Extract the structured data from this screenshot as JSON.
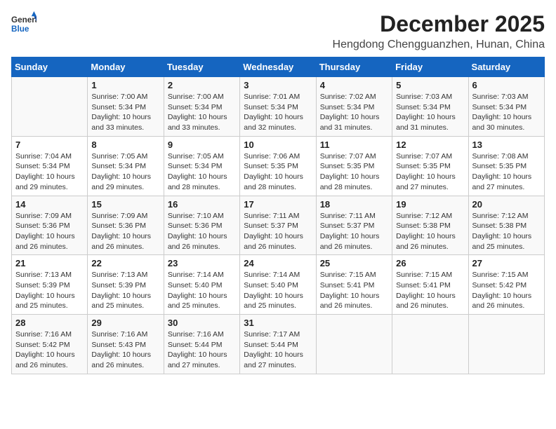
{
  "header": {
    "logo_general": "General",
    "logo_blue": "Blue",
    "month_year": "December 2025",
    "location": "Hengdong Chengguanzhen, Hunan, China"
  },
  "days_of_week": [
    "Sunday",
    "Monday",
    "Tuesday",
    "Wednesday",
    "Thursday",
    "Friday",
    "Saturday"
  ],
  "weeks": [
    [
      {
        "num": "",
        "detail": ""
      },
      {
        "num": "1",
        "detail": "Sunrise: 7:00 AM\nSunset: 5:34 PM\nDaylight: 10 hours\nand 33 minutes."
      },
      {
        "num": "2",
        "detail": "Sunrise: 7:00 AM\nSunset: 5:34 PM\nDaylight: 10 hours\nand 33 minutes."
      },
      {
        "num": "3",
        "detail": "Sunrise: 7:01 AM\nSunset: 5:34 PM\nDaylight: 10 hours\nand 32 minutes."
      },
      {
        "num": "4",
        "detail": "Sunrise: 7:02 AM\nSunset: 5:34 PM\nDaylight: 10 hours\nand 31 minutes."
      },
      {
        "num": "5",
        "detail": "Sunrise: 7:03 AM\nSunset: 5:34 PM\nDaylight: 10 hours\nand 31 minutes."
      },
      {
        "num": "6",
        "detail": "Sunrise: 7:03 AM\nSunset: 5:34 PM\nDaylight: 10 hours\nand 30 minutes."
      }
    ],
    [
      {
        "num": "7",
        "detail": "Sunrise: 7:04 AM\nSunset: 5:34 PM\nDaylight: 10 hours\nand 29 minutes."
      },
      {
        "num": "8",
        "detail": "Sunrise: 7:05 AM\nSunset: 5:34 PM\nDaylight: 10 hours\nand 29 minutes."
      },
      {
        "num": "9",
        "detail": "Sunrise: 7:05 AM\nSunset: 5:34 PM\nDaylight: 10 hours\nand 28 minutes."
      },
      {
        "num": "10",
        "detail": "Sunrise: 7:06 AM\nSunset: 5:35 PM\nDaylight: 10 hours\nand 28 minutes."
      },
      {
        "num": "11",
        "detail": "Sunrise: 7:07 AM\nSunset: 5:35 PM\nDaylight: 10 hours\nand 28 minutes."
      },
      {
        "num": "12",
        "detail": "Sunrise: 7:07 AM\nSunset: 5:35 PM\nDaylight: 10 hours\nand 27 minutes."
      },
      {
        "num": "13",
        "detail": "Sunrise: 7:08 AM\nSunset: 5:35 PM\nDaylight: 10 hours\nand 27 minutes."
      }
    ],
    [
      {
        "num": "14",
        "detail": "Sunrise: 7:09 AM\nSunset: 5:36 PM\nDaylight: 10 hours\nand 26 minutes."
      },
      {
        "num": "15",
        "detail": "Sunrise: 7:09 AM\nSunset: 5:36 PM\nDaylight: 10 hours\nand 26 minutes."
      },
      {
        "num": "16",
        "detail": "Sunrise: 7:10 AM\nSunset: 5:36 PM\nDaylight: 10 hours\nand 26 minutes."
      },
      {
        "num": "17",
        "detail": "Sunrise: 7:11 AM\nSunset: 5:37 PM\nDaylight: 10 hours\nand 26 minutes."
      },
      {
        "num": "18",
        "detail": "Sunrise: 7:11 AM\nSunset: 5:37 PM\nDaylight: 10 hours\nand 26 minutes."
      },
      {
        "num": "19",
        "detail": "Sunrise: 7:12 AM\nSunset: 5:38 PM\nDaylight: 10 hours\nand 26 minutes."
      },
      {
        "num": "20",
        "detail": "Sunrise: 7:12 AM\nSunset: 5:38 PM\nDaylight: 10 hours\nand 25 minutes."
      }
    ],
    [
      {
        "num": "21",
        "detail": "Sunrise: 7:13 AM\nSunset: 5:39 PM\nDaylight: 10 hours\nand 25 minutes."
      },
      {
        "num": "22",
        "detail": "Sunrise: 7:13 AM\nSunset: 5:39 PM\nDaylight: 10 hours\nand 25 minutes."
      },
      {
        "num": "23",
        "detail": "Sunrise: 7:14 AM\nSunset: 5:40 PM\nDaylight: 10 hours\nand 25 minutes."
      },
      {
        "num": "24",
        "detail": "Sunrise: 7:14 AM\nSunset: 5:40 PM\nDaylight: 10 hours\nand 25 minutes."
      },
      {
        "num": "25",
        "detail": "Sunrise: 7:15 AM\nSunset: 5:41 PM\nDaylight: 10 hours\nand 26 minutes."
      },
      {
        "num": "26",
        "detail": "Sunrise: 7:15 AM\nSunset: 5:41 PM\nDaylight: 10 hours\nand 26 minutes."
      },
      {
        "num": "27",
        "detail": "Sunrise: 7:15 AM\nSunset: 5:42 PM\nDaylight: 10 hours\nand 26 minutes."
      }
    ],
    [
      {
        "num": "28",
        "detail": "Sunrise: 7:16 AM\nSunset: 5:42 PM\nDaylight: 10 hours\nand 26 minutes."
      },
      {
        "num": "29",
        "detail": "Sunrise: 7:16 AM\nSunset: 5:43 PM\nDaylight: 10 hours\nand 26 minutes."
      },
      {
        "num": "30",
        "detail": "Sunrise: 7:16 AM\nSunset: 5:44 PM\nDaylight: 10 hours\nand 27 minutes."
      },
      {
        "num": "31",
        "detail": "Sunrise: 7:17 AM\nSunset: 5:44 PM\nDaylight: 10 hours\nand 27 minutes."
      },
      {
        "num": "",
        "detail": ""
      },
      {
        "num": "",
        "detail": ""
      },
      {
        "num": "",
        "detail": ""
      }
    ]
  ]
}
